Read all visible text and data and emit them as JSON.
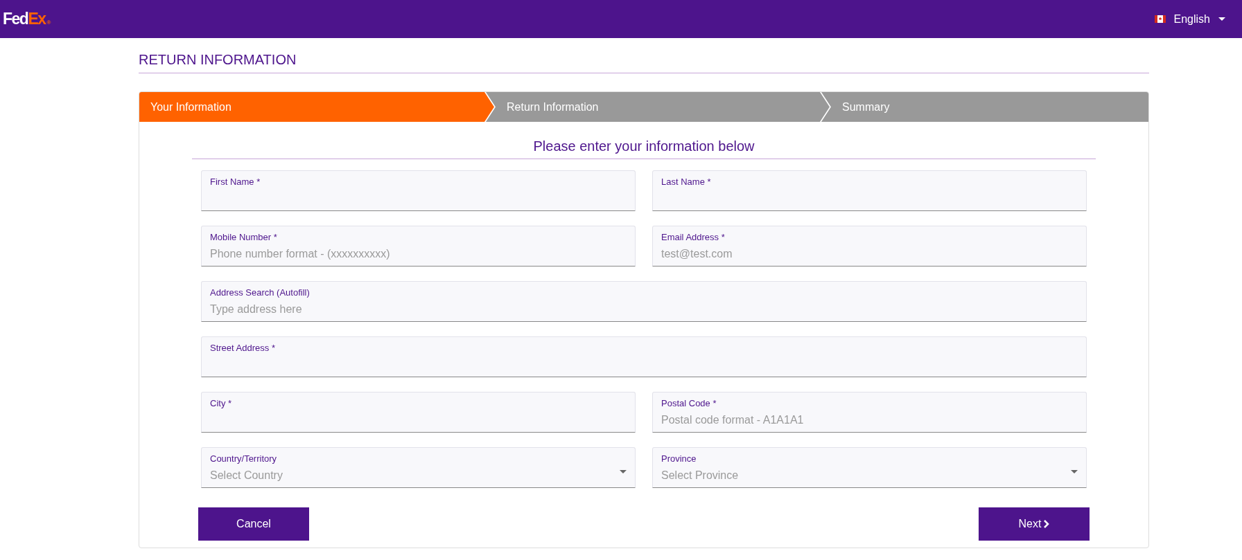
{
  "header": {
    "logo": {
      "part_1": "Fed",
      "part_2": "Ex",
      "mark": "®"
    },
    "language": "English"
  },
  "page_title": "RETURN INFORMATION",
  "steps": [
    {
      "label": "Your Information",
      "selected": true
    },
    {
      "label": "Return Information",
      "selected": false
    },
    {
      "label": "Summary",
      "selected": false
    }
  ],
  "form": {
    "heading": "Please enter your information below",
    "rows": [
      [
        {
          "kind": "text",
          "label": "First Name *"
        },
        {
          "kind": "text",
          "label": "Last Name *"
        }
      ],
      [
        {
          "kind": "text",
          "label": "Mobile Number *",
          "placeholder": "Phone number format - (xxxxxxxxxx)"
        },
        {
          "kind": "text",
          "label": "Email Address *",
          "placeholder": "test@test.com"
        }
      ],
      [
        {
          "kind": "text",
          "label": "Address Search (Autofill)",
          "placeholder": "Type address here"
        }
      ],
      [
        {
          "kind": "text",
          "label": "Street Address *"
        }
      ],
      [
        {
          "kind": "text",
          "label": "City *"
        },
        {
          "kind": "text",
          "label": "Postal Code *",
          "placeholder": "Postal code format - A1A1A1"
        }
      ],
      [
        {
          "kind": "select",
          "label": "Country/Territory",
          "placeholder": "Select Country"
        },
        {
          "kind": "select",
          "label": "Province",
          "placeholder": "Select Province"
        }
      ]
    ],
    "buttons": {
      "cancel": "Cancel",
      "next": "Next"
    }
  }
}
